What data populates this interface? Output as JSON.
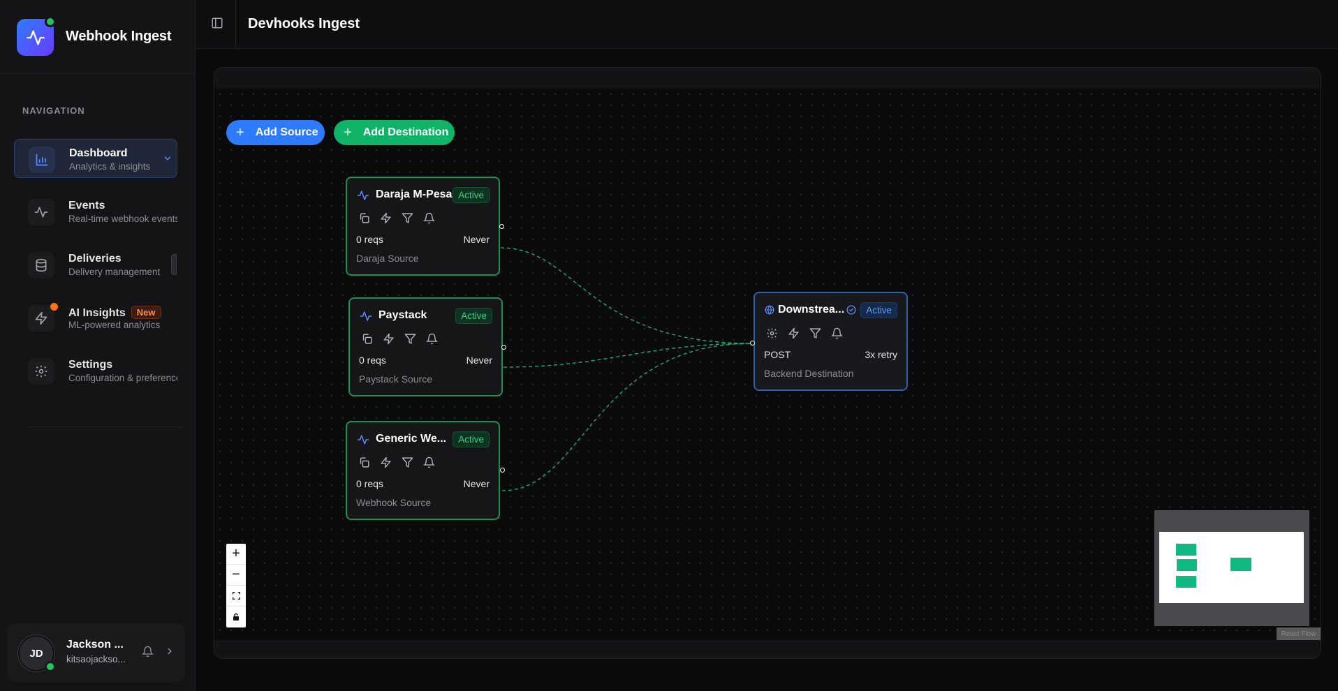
{
  "app": {
    "name": "Webhook Ingest"
  },
  "sidebar": {
    "heading": "NAVIGATION",
    "items": [
      {
        "title": "Dashboard",
        "subtitle": "Analytics & insights",
        "icon": "bar-chart-icon",
        "active": true
      },
      {
        "title": "Events",
        "subtitle": "Real-time webhook events",
        "icon": "activity-icon"
      },
      {
        "title": "Deliveries",
        "subtitle": "Delivery management",
        "icon": "database-icon"
      },
      {
        "title": "AI Insights",
        "subtitle": "ML-powered analytics",
        "icon": "zap-icon",
        "badge": "New"
      },
      {
        "title": "Settings",
        "subtitle": "Configuration & preferences",
        "icon": "gear-icon"
      }
    ]
  },
  "user": {
    "initials": "JD",
    "name": "Jackson ...",
    "email": "kitsaojackso..."
  },
  "header": {
    "title": "Devhooks Ingest"
  },
  "toolbar": {
    "add_source": "Add Source",
    "add_destination": "Add Destination"
  },
  "flow": {
    "sources": [
      {
        "title": "Daraja M-Pesa",
        "status": "Active",
        "requests": "0 reqs",
        "last": "Never",
        "type": "Daraja Source"
      },
      {
        "title": "Paystack",
        "status": "Active",
        "requests": "0 reqs",
        "last": "Never",
        "type": "Paystack Source"
      },
      {
        "title": "Generic We...",
        "status": "Active",
        "requests": "0 reqs",
        "last": "Never",
        "type": "Webhook Source"
      }
    ],
    "destination": {
      "title": "Downstrea...",
      "status": "Active",
      "method": "POST",
      "retry": "3x retry",
      "type": "Backend Destination"
    }
  },
  "zoom_controls": {
    "zoom_in": "+",
    "zoom_out": "−"
  },
  "attribution": "React Flow",
  "colors": {
    "primary": "#2f7bff",
    "success": "#10b469",
    "edge": "#10b981",
    "accent_orange": "#f97316"
  }
}
